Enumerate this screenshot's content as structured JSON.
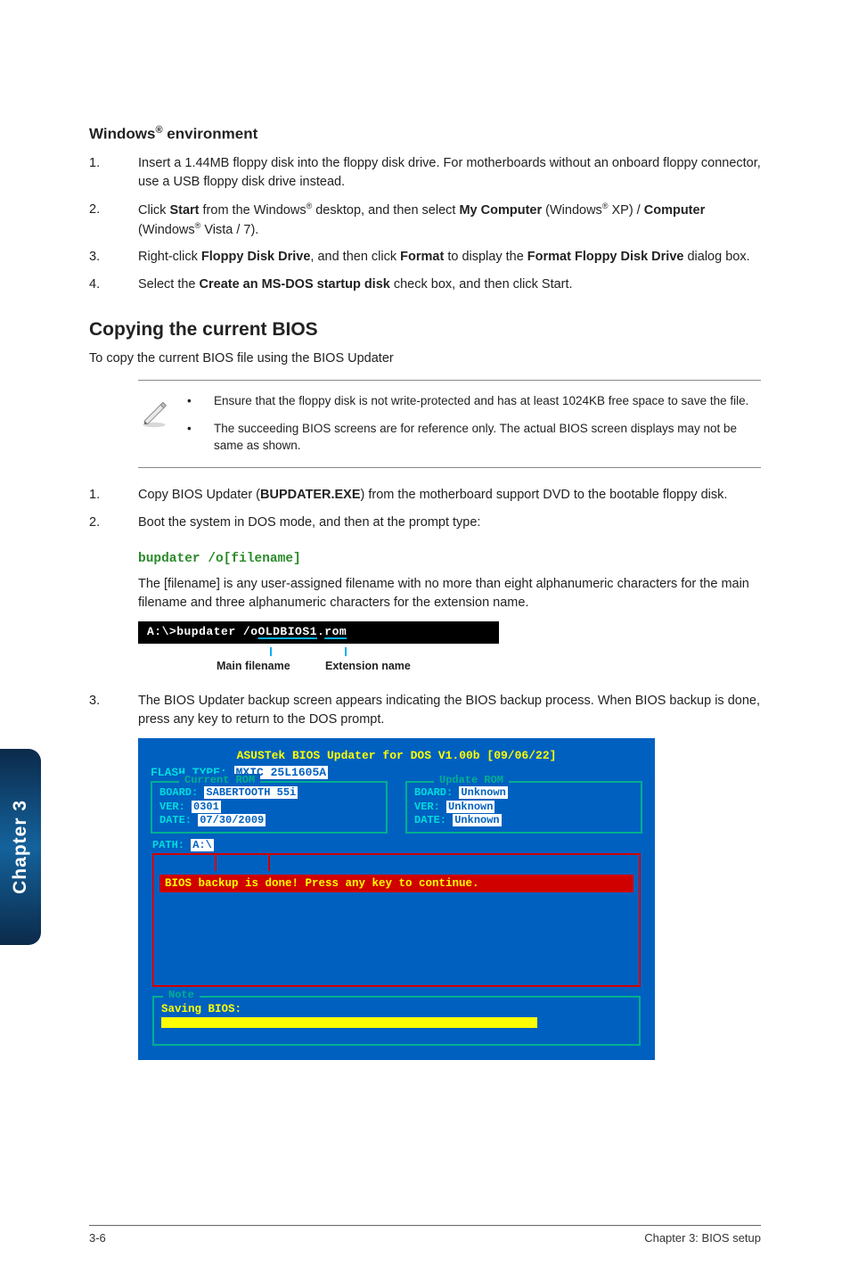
{
  "section1": {
    "heading_pre": "Windows",
    "heading_sup": "®",
    "heading_post": " environment",
    "items": [
      {
        "n": "1.",
        "text": "Insert a 1.44MB floppy disk into the floppy disk drive. For motherboards without an onboard floppy connector, use a USB floppy disk drive instead."
      },
      {
        "n": "2.",
        "html": "Click <b>Start</b> from the Windows<sup>®</sup> desktop, and then select <b>My Computer</b> (Windows<sup>®</sup> XP) / <b>Computer</b> (Windows<sup>®</sup> Vista / 7)."
      },
      {
        "n": "3.",
        "html": "Right-click <b>Floppy Disk Drive</b>, and then click <b>Format</b> to display the <b>Format Floppy Disk Drive</b> dialog box."
      },
      {
        "n": "4.",
        "html": "Select the <b>Create an MS-DOS startup disk</b> check box, and then click Start."
      }
    ]
  },
  "section2": {
    "heading": "Copying the current BIOS",
    "intro": "To copy the current BIOS file using the BIOS Updater",
    "notes": [
      "Ensure that the floppy disk is not write-protected and has at least 1024KB free space to save the file.",
      "The succeeding BIOS screens are for reference only. The actual BIOS screen displays may not be same as shown."
    ],
    "steps": [
      {
        "n": "1.",
        "html": "Copy BIOS Updater (<b>BUPDATER.EXE</b>) from the motherboard support DVD to the bootable floppy disk."
      },
      {
        "n": "2.",
        "text": "Boot the system in DOS mode, and then at the prompt type:"
      }
    ],
    "code": "bupdater /o[filename]",
    "fname_desc": "The [filename] is any user-assigned filename with no more than eight alphanumeric characters for the main filename and three alphanumeric characters for the extension name.",
    "terminal": {
      "prefix": "A:\\>bupdater /o",
      "main": "OLDBIOS1",
      "dot": ".",
      "ext": "rom"
    },
    "term_labels": {
      "main": "Main filename",
      "ext": "Extension name"
    },
    "step3": {
      "n": "3.",
      "text": "The BIOS Updater backup screen appears indicating the BIOS backup process. When BIOS backup is done, press any key to return to the DOS prompt."
    }
  },
  "bios": {
    "title": "ASUSTek BIOS Updater for DOS V1.00b [09/06/22]",
    "flash_label": "FLASH TYPE: ",
    "flash_val": "MXIC 25L1605A",
    "current_legend": "Current ROM",
    "update_legend": "Update ROM",
    "current": {
      "board_label": "BOARD: ",
      "board_val": "SABERTOOTH 55i",
      "ver_label": "VER: ",
      "ver_val": "0301",
      "date_label": "DATE: ",
      "date_val": "07/30/2009"
    },
    "update": {
      "board_label": "BOARD: ",
      "board_val": "Unknown",
      "ver_label": "VER: ",
      "ver_val": "Unknown",
      "date_label": "DATE: ",
      "date_val": "Unknown"
    },
    "path_label": "PATH: ",
    "path_val": "A:\\",
    "banner": "BIOS backup is done! Press any key to continue.",
    "note_legend": "Note",
    "saving": "Saving BIOS:"
  },
  "sidebar": "Chapter 3",
  "footer": {
    "left": "3-6",
    "right": "Chapter 3: BIOS setup"
  }
}
